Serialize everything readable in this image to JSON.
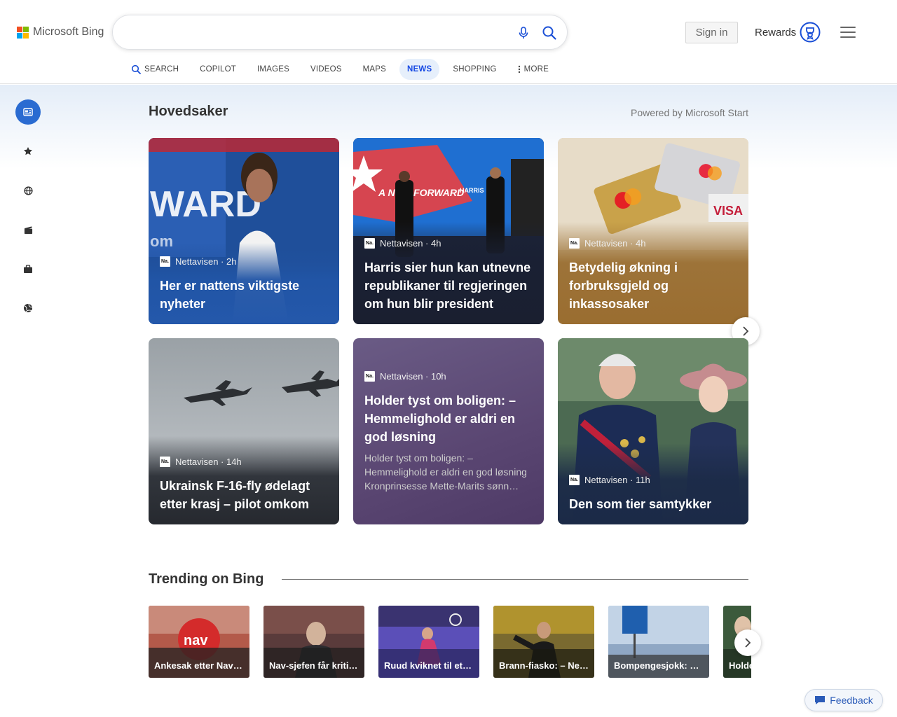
{
  "header": {
    "logo_text": "Microsoft Bing",
    "search": {
      "value": "",
      "placeholder": ""
    },
    "sign_in": "Sign in",
    "rewards": "Rewards"
  },
  "tabs": [
    {
      "label": "SEARCH",
      "icon": "search-icon"
    },
    {
      "label": "COPILOT"
    },
    {
      "label": "IMAGES"
    },
    {
      "label": "VIDEOS"
    },
    {
      "label": "MAPS"
    },
    {
      "label": "NEWS",
      "active": true
    },
    {
      "label": "SHOPPING"
    },
    {
      "label": "MORE",
      "icon": "more-vertical-icon"
    }
  ],
  "rail": [
    {
      "icon": "news-icon",
      "active": true
    },
    {
      "icon": "star-icon"
    },
    {
      "icon": "globe-icon"
    },
    {
      "icon": "clapperboard-icon"
    },
    {
      "icon": "briefcase-icon"
    },
    {
      "icon": "sports-ball-icon"
    }
  ],
  "main": {
    "title": "Hovedsaker",
    "powered_by": "Powered by Microsoft Start",
    "cards": [
      {
        "source": "Nettavisen · 2h",
        "headline": "Her er nattens viktigste nyheter"
      },
      {
        "source": "Nettavisen · 4h",
        "headline": "Harris sier hun kan utnevne republikaner til regjeringen om hun blir president"
      },
      {
        "source": "Nettavisen · 4h",
        "headline": "Betydelig økning i forbruksgjeld og inkassosaker"
      },
      {
        "source": "Nettavisen · 14h",
        "headline": "Ukrainsk F-16-fly ødelagt etter krasj – pilot omkom"
      },
      {
        "source": "Nettavisen · 10h",
        "headline": "Holder tyst om boligen: – Hemmelighold er aldri en god løsning",
        "snippet": "Holder tyst om boligen: – Hemmelighold er aldri en god løsning Kronprinsesse Mette-Marits sønn…"
      },
      {
        "source": "Nettavisen · 11h",
        "headline": "Den som tier samtykker"
      }
    ],
    "source_logo": "Na."
  },
  "trending": {
    "title": "Trending on Bing",
    "items": [
      {
        "label": "Ankesak etter Nav…"
      },
      {
        "label": "Nav-sjefen får kriti…"
      },
      {
        "label": "Ruud kviknet til et…"
      },
      {
        "label": "Brann-fiasko: – Ne…"
      },
      {
        "label": "Bompengesjokk: …"
      },
      {
        "label": "Holde…"
      }
    ]
  },
  "feedback": "Feedback",
  "colors": {
    "accent": "#174ae4",
    "rail_active": "#2a6bd1"
  }
}
